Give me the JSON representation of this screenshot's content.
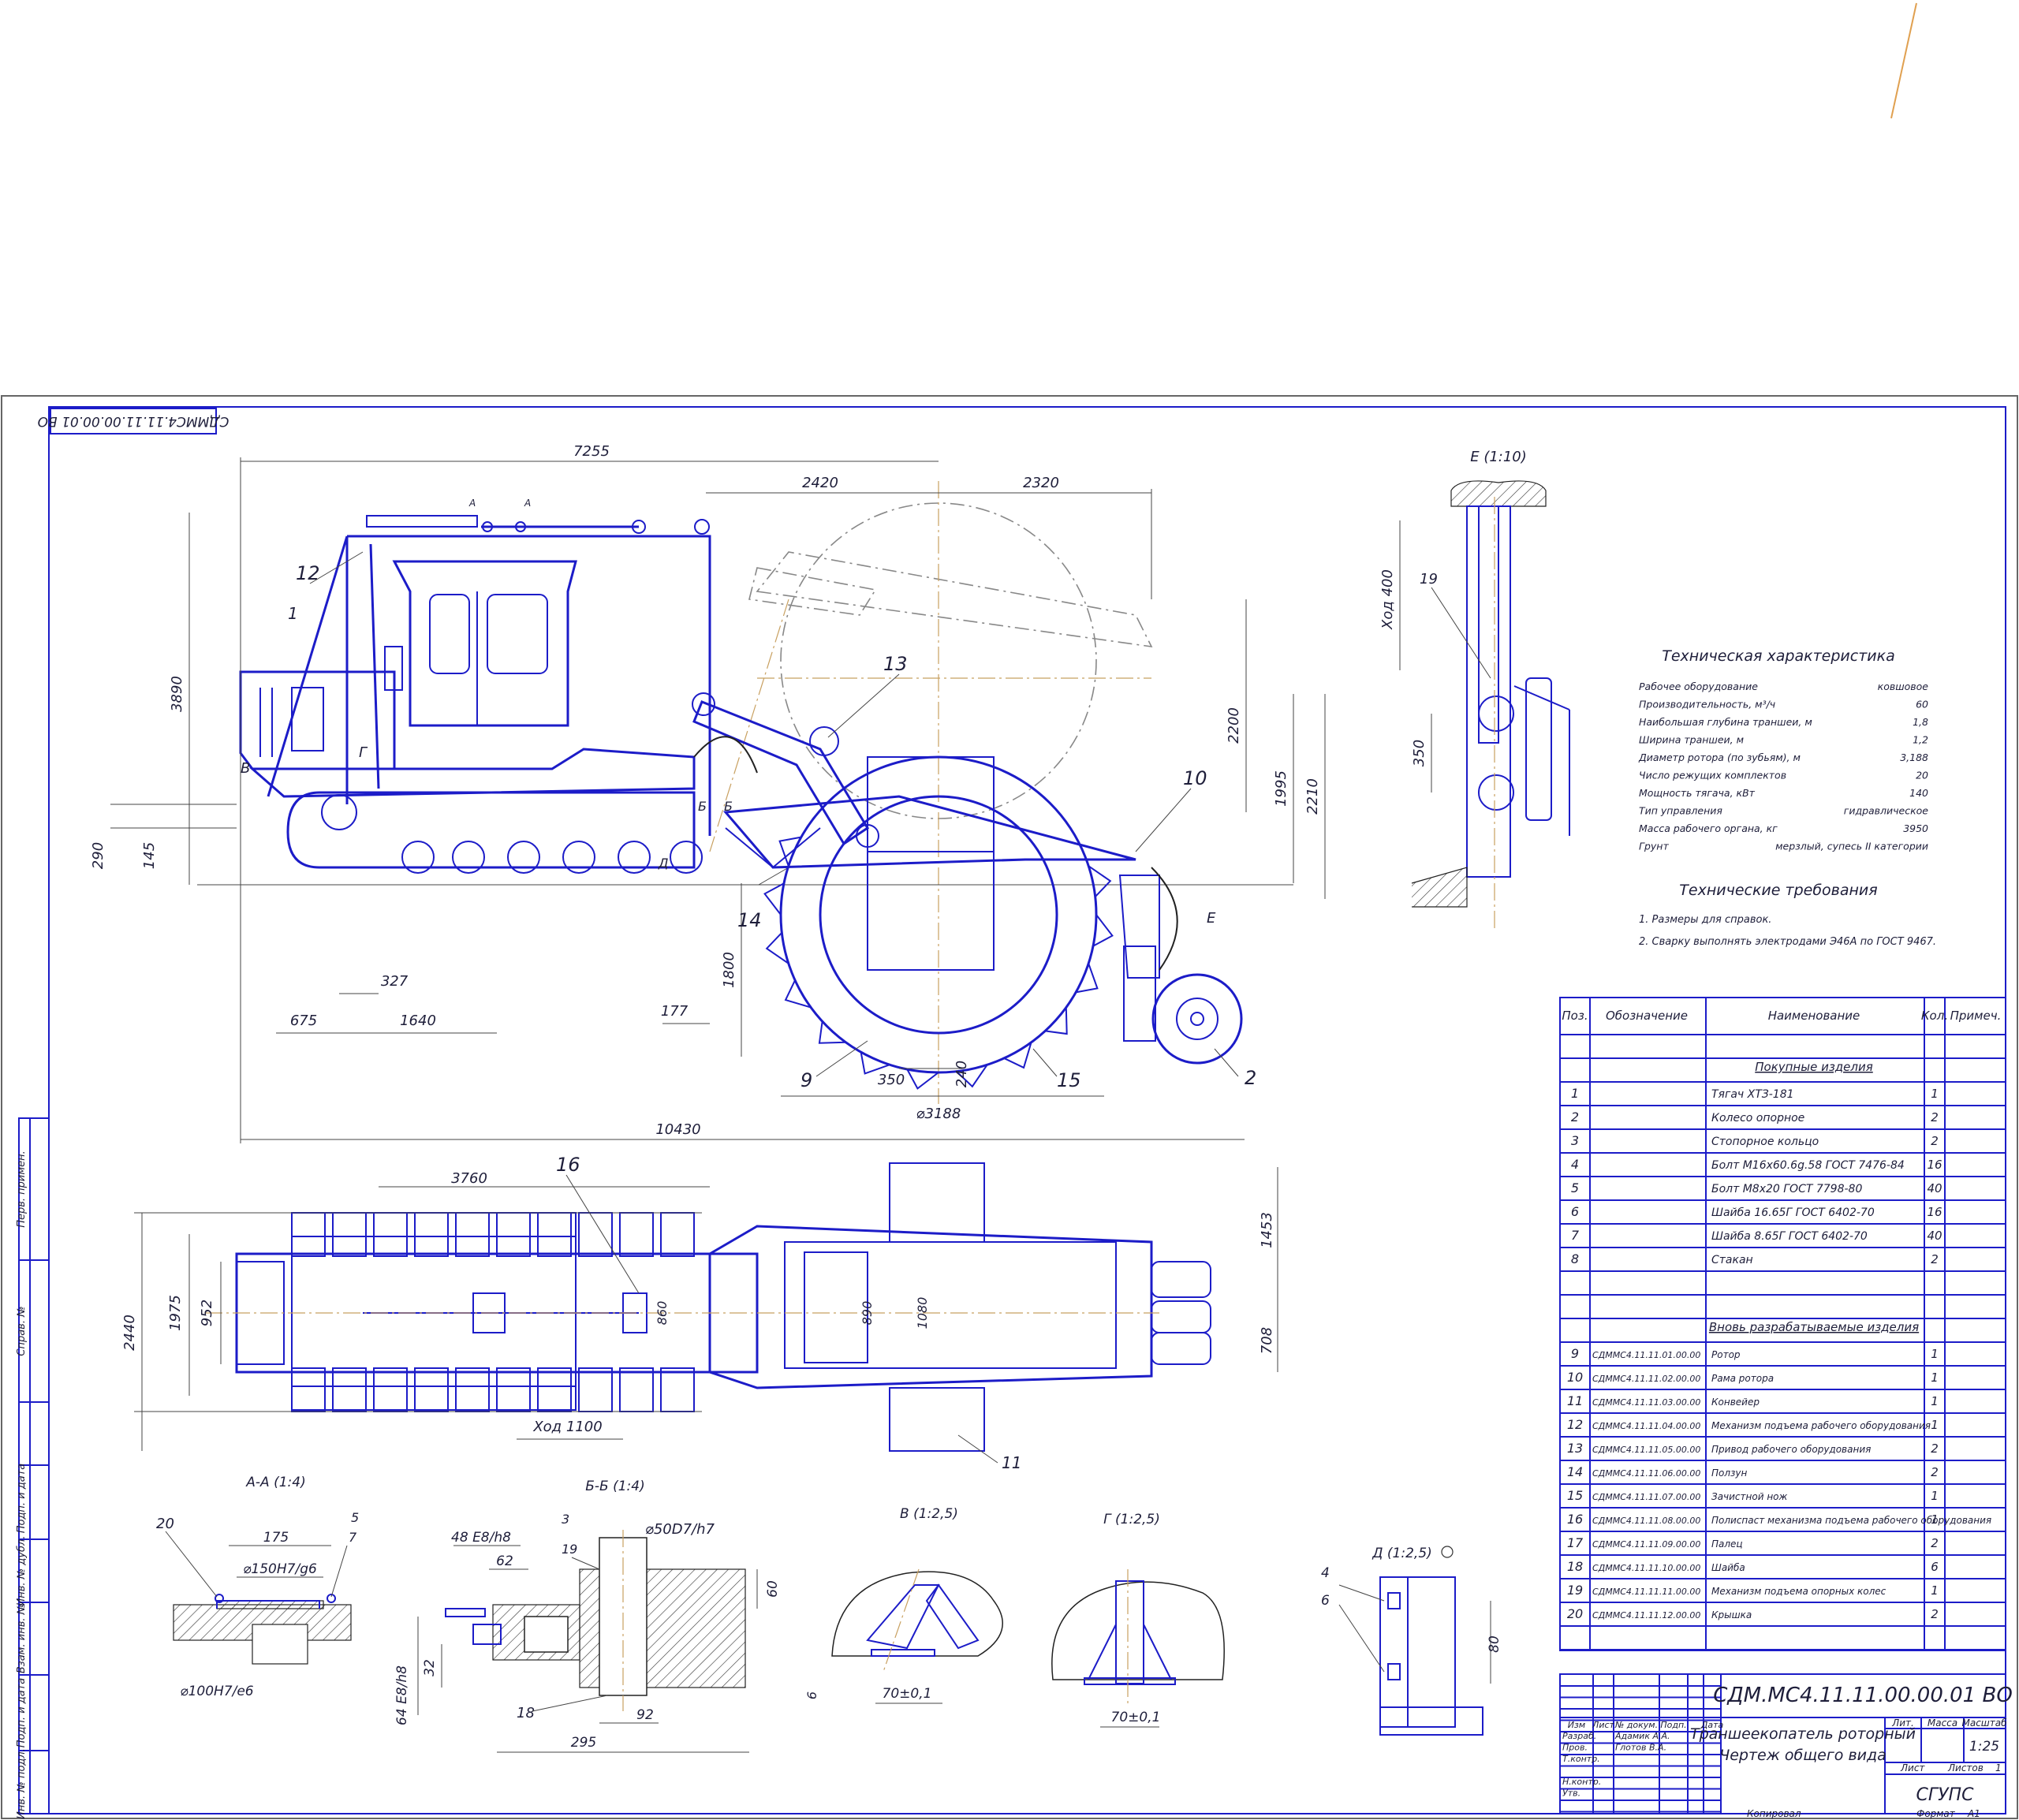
{
  "drawing": {
    "code_stamp": "СДММС4.11.11.00.00.01 ВО",
    "designation": "СДМ.МС4.11.11.00.00.01 ВО",
    "title_line1": "Траншеекопатель роторный",
    "title_line2": "Чертеж общего вида",
    "organization": "СГУПС",
    "scale": "1:25",
    "sheet_label": "Лист",
    "sheets_label": "Листов",
    "sheets_count": "1",
    "lit_label": "Лит.",
    "mass_label": "Масса",
    "scale_label": "Масштаб",
    "copied_label": "Копировал",
    "format_label": "Формат",
    "format_value": "А1",
    "rows_left": [
      "Изм",
      "Лист",
      "№ докум.",
      "Подп.",
      "Дата"
    ],
    "roles": [
      {
        "role": "Разраб.",
        "name": "Адамик А.А."
      },
      {
        "role": "Пров.",
        "name": "Глотов В.А."
      },
      {
        "role": "Т.контр.",
        "name": ""
      },
      {
        "role": "",
        "name": ""
      },
      {
        "role": "Н.контр.",
        "name": ""
      },
      {
        "role": "Утв.",
        "name": ""
      }
    ]
  },
  "side_margin_labels": [
    "Перв. примен.",
    "Справ. №",
    "Подп. и дата",
    "Инв. № дубл.",
    "Взам. инв. №",
    "Подп. и дата",
    "Инв. № подл."
  ],
  "views": {
    "main_dims": [
      "7255",
      "2420",
      "2320",
      "3890",
      "2200",
      "1995",
      "2210",
      "290",
      "145",
      "327",
      "675",
      "1640",
      "177",
      "1800",
      "350",
      "240",
      "⌀3188",
      "10430"
    ],
    "main_callouts": [
      "12",
      "1",
      "13",
      "10",
      "В",
      "Г",
      "Б",
      "Б",
      "Д",
      "14",
      "Е",
      "9",
      "15",
      "2",
      "А",
      "А"
    ],
    "plan_dims": [
      "3760",
      "2440",
      "1975",
      "952",
      "860",
      "890",
      "1080",
      "1453",
      "708",
      "Ход 1100"
    ],
    "plan_callouts": [
      "16",
      "11"
    ],
    "view_e_title": "Е (1:10)",
    "view_e_dims": [
      "Ход 400",
      "350"
    ],
    "view_e_callouts": [
      "19"
    ],
    "section_aa": {
      "title": "А-А (1:4)",
      "dims": [
        "175",
        "⌀150H7/g6",
        "⌀100H7/e6"
      ],
      "callouts": [
        "20",
        "5",
        "7"
      ]
    },
    "section_bb": {
      "title": "Б-Б (1:4)",
      "dims": [
        "48 E8/h8",
        "62",
        "⌀50D7/h7",
        "60",
        "32",
        "64 E8/h8",
        "92",
        "295"
      ],
      "callouts": [
        "3",
        "19",
        "18"
      ]
    },
    "view_v": {
      "title": "В (1:2,5)",
      "dims": [
        "6",
        "70±0,1"
      ]
    },
    "view_g": {
      "title": "Г (1:2,5)",
      "dims": [
        "70±0,1"
      ]
    },
    "view_d": {
      "title": "Д (1:2,5)",
      "dims": [
        "80"
      ],
      "callouts": [
        "4",
        "6"
      ]
    }
  },
  "tech_spec": {
    "title": "Техническая характеристика",
    "rows": [
      {
        "k": "Рабочее оборудование",
        "v": "ковшовое"
      },
      {
        "k": "Производительность, м³/ч",
        "v": "60"
      },
      {
        "k": "Наибольшая глубина траншеи, м",
        "v": "1,8"
      },
      {
        "k": "Ширина траншеи, м",
        "v": "1,2"
      },
      {
        "k": "Диаметр ротора (по зубьям), м",
        "v": "3,188"
      },
      {
        "k": "Число режущих комплектов",
        "v": "20"
      },
      {
        "k": "Мощность тягача, кВт",
        "v": "140"
      },
      {
        "k": "Тип управления",
        "v": "гидравлическое"
      },
      {
        "k": "Масса рабочего органа, кг",
        "v": "3950"
      },
      {
        "k": "Грунт",
        "v": "мерзлый, супесь II категории"
      }
    ]
  },
  "tech_req": {
    "title": "Технические требования",
    "items": [
      "1. Размеры для справок.",
      "2. Сварку выполнять электродами Э46А по ГОСТ 9467."
    ]
  },
  "bom": {
    "headers": [
      "Поз.",
      "Обозначение",
      "Наименование",
      "Кол.",
      "Примеч."
    ],
    "section1": "Покупные изделия",
    "section2": "Вновь разрабатываемые изделия",
    "rows1": [
      {
        "pos": "1",
        "code": "",
        "name": "Тягач ХТЗ-181",
        "qty": "1"
      },
      {
        "pos": "2",
        "code": "",
        "name": "Колесо опорное",
        "qty": "2"
      },
      {
        "pos": "3",
        "code": "",
        "name": "Стопорное кольцо",
        "qty": "2"
      },
      {
        "pos": "4",
        "code": "",
        "name": "Болт М16х60.6g.58 ГОСТ 7476-84",
        "qty": "16"
      },
      {
        "pos": "5",
        "code": "",
        "name": "Болт М8х20 ГОСТ 7798-80",
        "qty": "40"
      },
      {
        "pos": "6",
        "code": "",
        "name": "Шайба 16.65Г ГОСТ 6402-70",
        "qty": "16"
      },
      {
        "pos": "7",
        "code": "",
        "name": "Шайба 8.65Г ГОСТ 6402-70",
        "qty": "40"
      },
      {
        "pos": "8",
        "code": "",
        "name": "Стакан",
        "qty": "2"
      }
    ],
    "rows2": [
      {
        "pos": "9",
        "code": "СДММС4.11.11.01.00.00",
        "name": "Ротор",
        "qty": "1"
      },
      {
        "pos": "10",
        "code": "СДММС4.11.11.02.00.00",
        "name": "Рама ротора",
        "qty": "1"
      },
      {
        "pos": "11",
        "code": "СДММС4.11.11.03.00.00",
        "name": "Конвейер",
        "qty": "1"
      },
      {
        "pos": "12",
        "code": "СДММС4.11.11.04.00.00",
        "name": "Механизм подъема рабочего оборудования",
        "qty": "1"
      },
      {
        "pos": "13",
        "code": "СДММС4.11.11.05.00.00",
        "name": "Привод рабочего оборудования",
        "qty": "2"
      },
      {
        "pos": "14",
        "code": "СДММС4.11.11.06.00.00",
        "name": "Ползун",
        "qty": "2"
      },
      {
        "pos": "15",
        "code": "СДММС4.11.11.07.00.00",
        "name": "Зачистной нож",
        "qty": "1"
      },
      {
        "pos": "16",
        "code": "СДММС4.11.11.08.00.00",
        "name": "Полиспаст механизма подъема рабочего оборудования",
        "qty": "1"
      },
      {
        "pos": "17",
        "code": "СДММС4.11.11.09.00.00",
        "name": "Палец",
        "qty": "2"
      },
      {
        "pos": "18",
        "code": "СДММС4.11.11.10.00.00",
        "name": "Шайба",
        "qty": "6"
      },
      {
        "pos": "19",
        "code": "СДММС4.11.11.11.00.00",
        "name": "Механизм подъема опорных колес",
        "qty": "1"
      },
      {
        "pos": "20",
        "code": "СДММС4.11.11.12.00.00",
        "name": "Крышка",
        "qty": "2"
      }
    ]
  },
  "colors": {
    "line": "#1c1cc8",
    "centerline": "#c8a060",
    "ink": "#1e1e3a"
  }
}
